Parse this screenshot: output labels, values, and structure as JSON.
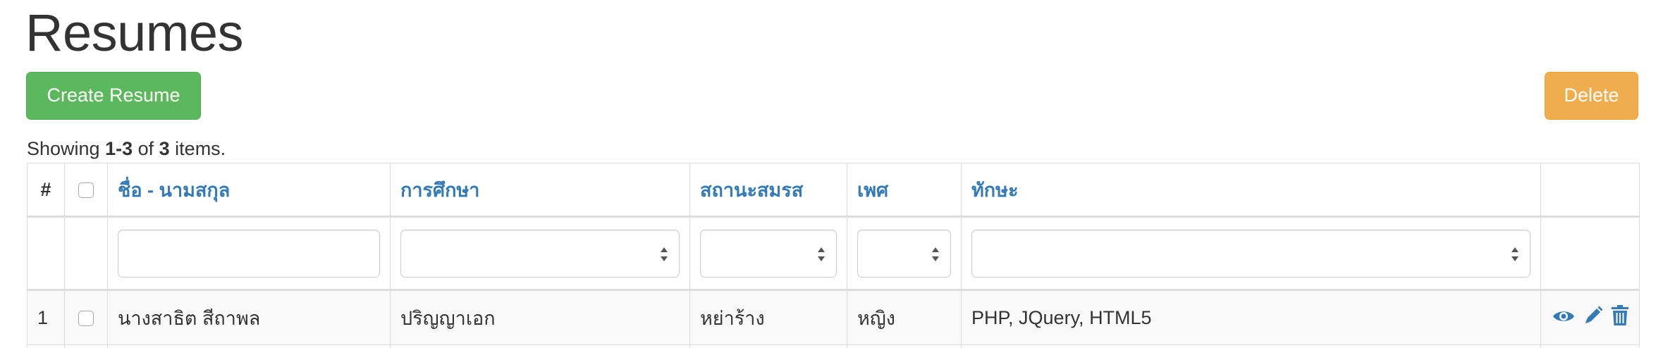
{
  "page": {
    "title": "Resumes"
  },
  "toolbar": {
    "create_label": "Create Resume",
    "delete_label": "Delete"
  },
  "summary": {
    "prefix": "Showing ",
    "range": "1-3",
    "middle": " of ",
    "total": "3",
    "suffix": " items."
  },
  "table": {
    "headers": {
      "index": "#",
      "name": "ชื่อ - นามสกุล",
      "education": "การศึกษา",
      "marital": "สถานะสมรส",
      "gender": "เพศ",
      "skills": "ทักษะ"
    },
    "filters": {
      "name_value": "",
      "education_selected": "",
      "marital_selected": "",
      "gender_selected": "",
      "skills_selected": ""
    },
    "rows": [
      {
        "index": "1",
        "name": "นางสาธิต สีถาพล",
        "education": "ปริญญาเอก",
        "marital": "หย่าร้าง",
        "gender": "หญิง",
        "skills": "PHP, JQuery, HTML5"
      }
    ]
  },
  "colors": {
    "link": "#337ab7",
    "success": "#5cb85c",
    "warning": "#f0ad4e",
    "border": "#dddddd"
  },
  "icons": {
    "view": "eye-icon",
    "edit": "pencil-icon",
    "delete": "trash-icon"
  }
}
